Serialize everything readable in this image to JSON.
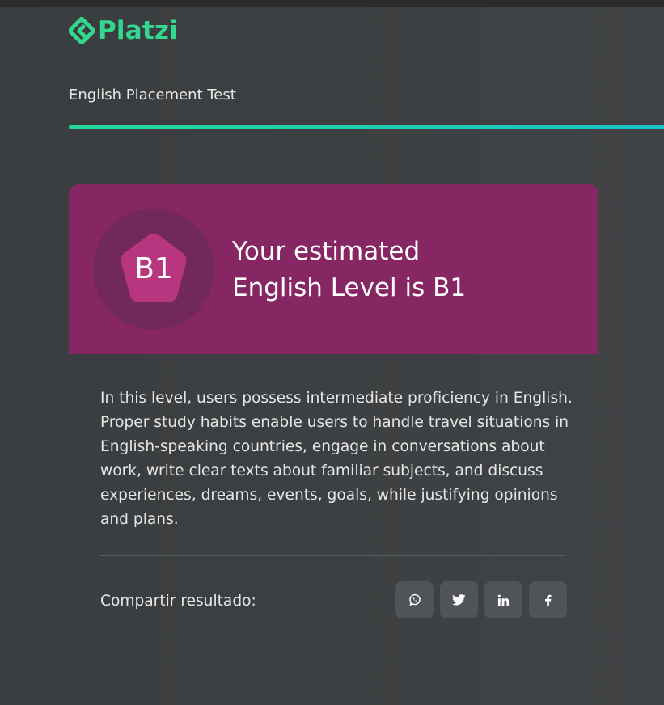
{
  "brand": {
    "name": "Platzi",
    "accent": "#33d88f"
  },
  "test": {
    "title": "English Placement Test",
    "progress_percent": 100
  },
  "result": {
    "level": "B1",
    "line1": "Your estimated",
    "line2": "English Level is B1",
    "card_color": "#862663",
    "badge_color": "#b8367f"
  },
  "description": "In this level, users possess intermediate proficiency in English. Proper study habits enable users to handle travel situations in English-speaking countries, engage in conversations about work, write clear texts about familiar subjects, and discuss experiences, dreams, events, goals, while justifying opinions and plans.",
  "share": {
    "label": "Compartir resultado:",
    "buttons": [
      {
        "icon": "whatsapp-icon"
      },
      {
        "icon": "twitter-icon"
      },
      {
        "icon": "linkedin-icon"
      },
      {
        "icon": "facebook-icon"
      }
    ]
  }
}
